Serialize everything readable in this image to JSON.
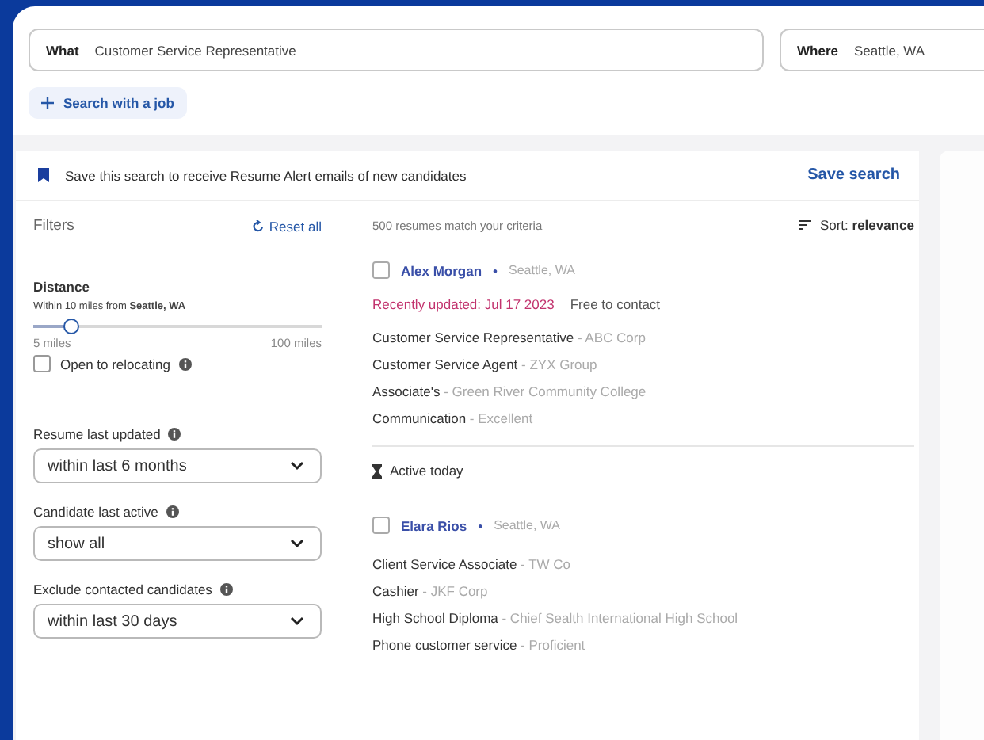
{
  "search": {
    "what_label": "What",
    "what_value": "Customer Service Representative",
    "where_label": "Where",
    "where_value": "Seattle, WA"
  },
  "search_with_job": {
    "label": "Search with a job"
  },
  "save_banner": {
    "text": "Save this search to receive Resume Alert emails of new candidates",
    "button": "Save search"
  },
  "filters": {
    "title": "Filters",
    "reset": "Reset all",
    "distance": {
      "title": "Distance",
      "caption": "Within 10 miles from **Seattle, WA**",
      "level": 0.13,
      "min": "5 miles",
      "max": "100 miles"
    },
    "relocating": {
      "label": "Open to relocating",
      "checked": false
    },
    "selects": [
      {
        "label": "Resume last updated",
        "value": "within last 6 months"
      },
      {
        "label": "Candidate last active",
        "value": "show all"
      },
      {
        "label": "Exclude contacted candidates",
        "value": "within last 30 days"
      }
    ]
  },
  "results": {
    "count": "500 resumes match your criteria",
    "sort": "Sort: **relevance**",
    "candidates": [
      {
        "name": "Alex Morgan",
        "separator": "•",
        "location": "Seattle, WA",
        "checked": false,
        "updated": "Recently updated: Jul 17 2023",
        "contact": "Free to contact",
        "activity": "Active today",
        "lines": [
          {
            "title": "Customer Service Representative",
            "detail": "- ABC Corp"
          },
          {
            "title": "Customer Service Agent",
            "detail": "- ZYX Group"
          },
          {
            "title": "Associate's",
            "detail": "- Green River Community College"
          },
          {
            "title": "Communication",
            "detail": "- Excellent"
          }
        ]
      },
      {
        "name": "Elara Rios",
        "separator": "•",
        "location": "Seattle, WA",
        "checked": false,
        "lines": [
          {
            "title": "Client Service Associate",
            "detail": "- TW Co"
          },
          {
            "title": "Cashier",
            "detail": "- JKF Corp"
          },
          {
            "title": "High School Diploma",
            "detail": "- Chief Sealth International High School"
          },
          {
            "title": "Phone customer service",
            "detail": "- Proficient"
          }
        ]
      }
    ]
  }
}
